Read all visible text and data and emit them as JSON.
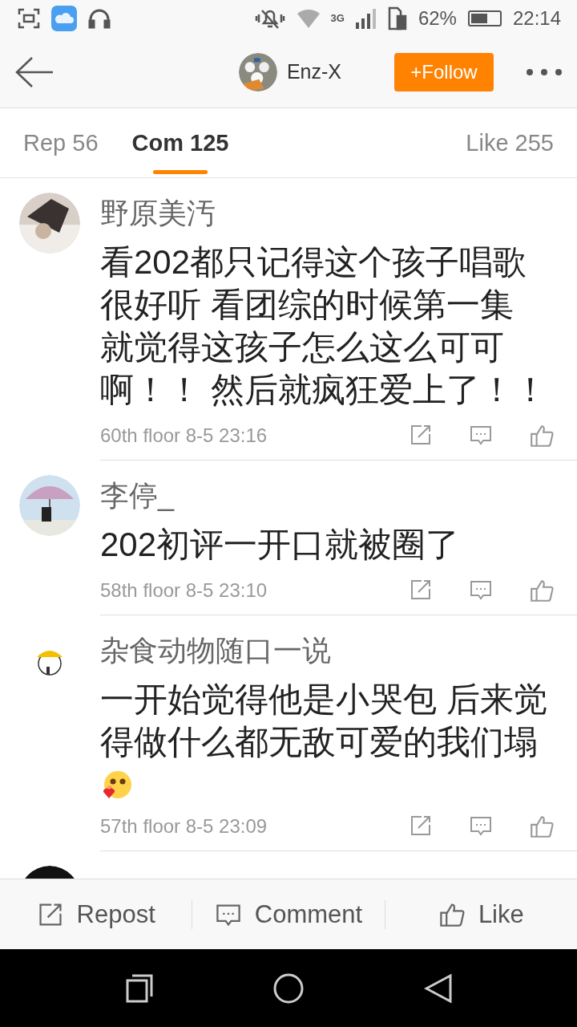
{
  "status_bar": {
    "network": "3G",
    "battery_text": "62%",
    "time": "22:14"
  },
  "header": {
    "user_name": "Enz-X",
    "follow_label": "+Follow"
  },
  "tabs": [
    {
      "label": "Rep 56",
      "selected": false
    },
    {
      "label": "Com 125",
      "selected": true
    },
    {
      "label": "Like 255",
      "selected": false
    }
  ],
  "comments": [
    {
      "kind": "full",
      "author": "野原美汚",
      "lines": [
        "看202都只记得这个孩子唱歌",
        "很好听 看团综的时候第一集",
        "就觉得这孩子怎么这么可可",
        "啊！！ 然后就疯狂爱上了！！"
      ],
      "emoji": false,
      "meta": "60th floor 8-5 23:16"
    },
    {
      "kind": "full",
      "author": "李停_",
      "lines": [
        "202初评一开口就被圈了"
      ],
      "emoji": false,
      "meta": "58th floor 8-5 23:10"
    },
    {
      "kind": "full",
      "author": "杂食动物随口一说",
      "lines": [
        "一开始觉得他是小哭包 后来觉",
        "得做什么都无敌可爱的我们塌"
      ],
      "emoji": true,
      "meta": "57th floor 8-5 23:09"
    },
    {
      "kind": "partial"
    }
  ],
  "action_bar": [
    {
      "kind": "repost",
      "label": "Repost"
    },
    {
      "kind": "comment",
      "label": "Comment"
    },
    {
      "kind": "like",
      "label": "Like"
    }
  ]
}
